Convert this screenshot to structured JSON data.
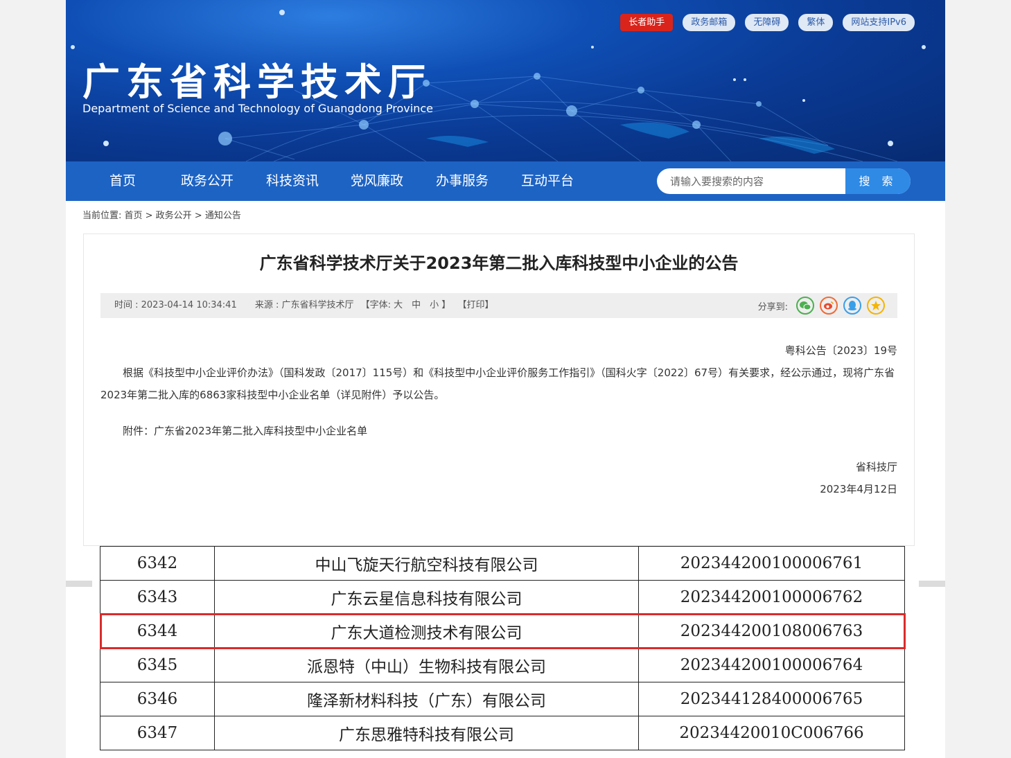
{
  "header": {
    "site_title": "广东省科学技术厅",
    "site_subtitle": "Department of Science and Technology of Guangdong Province",
    "top_links": [
      "长者助手",
      "政务邮箱",
      "无障碍",
      "繁体",
      "网站支持IPv6"
    ]
  },
  "nav": {
    "items": [
      "首页",
      "政务公开",
      "科技资讯",
      "党风廉政",
      "办事服务",
      "互动平台"
    ],
    "search_placeholder": "请输入要搜索的内容",
    "search_button": "搜 索"
  },
  "breadcrumb": "当前位置: 首页 > 政务公开 > 通知公告",
  "article": {
    "title": "广东省科学技术厅关于2023年第二批入库科技型中小企业的公告",
    "time": "时间 : 2023-04-14 10:34:41",
    "source": "来源 : 广东省科学技术厅",
    "font_size": "【字体: 大　中　小 】",
    "print": "【打印】",
    "share_label": "分享到:",
    "share_icons": [
      "wechat-icon",
      "weibo-icon",
      "qq-icon",
      "qzone-icon"
    ],
    "doc_no": "粤科公告〔2023〕19号",
    "paragraph": "根据《科技型中小企业评价办法》（国科发政〔2017〕115号）和《科技型中小企业评价服务工作指引》（国科火字〔2022〕67号）有关要求，经公示通过，现将广东省2023年第二批入库的6863家科技型中小企业名单（详见附件）予以公告。",
    "attachment": "附件：广东省2023年第二批入库科技型中小企业名单",
    "signer": "省科技厅",
    "date": "2023年4月12日"
  },
  "table": {
    "rows": [
      {
        "no": "6342",
        "name": "中山飞旋天行航空科技有限公司",
        "code": "202344200100006761"
      },
      {
        "no": "6343",
        "name": "广东云星信息科技有限公司",
        "code": "202344200100006762"
      },
      {
        "no": "6344",
        "name": "广东大道检测技术有限公司",
        "code": "202344200108006763"
      },
      {
        "no": "6345",
        "name": "派恩特（中山）生物科技有限公司",
        "code": "202344200100006764"
      },
      {
        "no": "6346",
        "name": "隆泽新材料科技（广东）有限公司",
        "code": "202344128400006765"
      },
      {
        "no": "6347",
        "name": "广东思雅特科技有限公司",
        "code": "20234420010C006766"
      }
    ],
    "highlighted_row": "6344",
    "highlight_color": "#d92b2b"
  }
}
